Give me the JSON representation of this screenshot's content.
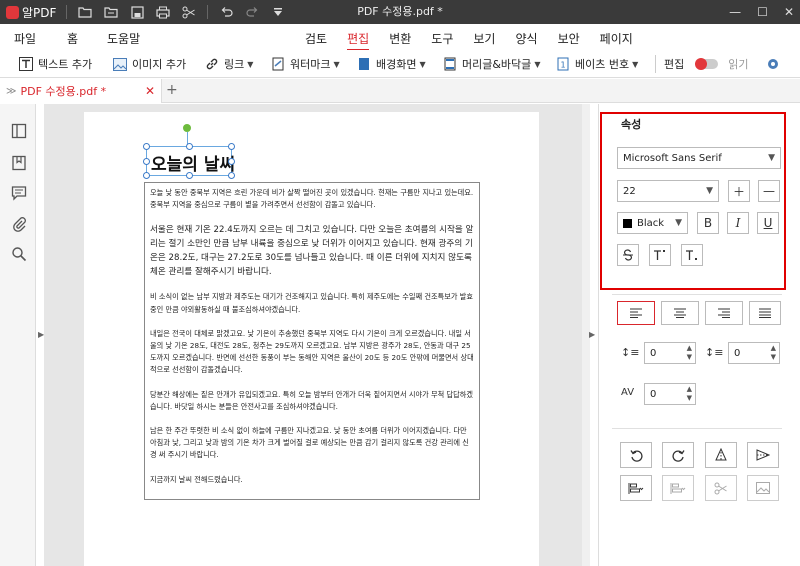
{
  "titlebar": {
    "app_name": "알PDF",
    "doc_title": "PDF 수정용.pdf *",
    "icons": [
      "folder-icon",
      "open-icon",
      "save-icon",
      "print-icon",
      "scissors-icon",
      "undo-icon",
      "redo-icon",
      "more-icon"
    ],
    "controls": [
      "minimize",
      "maximize",
      "close"
    ]
  },
  "menu": {
    "left": [
      "파일",
      "홈",
      "도움말"
    ],
    "center": [
      "검토",
      "편집",
      "변환",
      "도구",
      "보기",
      "양식",
      "보안",
      "페이지"
    ],
    "active": "편집"
  },
  "toolbar": {
    "add_text": "텍스트 추가",
    "add_image": "이미지 추가",
    "link": "링크",
    "watermark": "워터마크",
    "background": "배경화면",
    "header_footer": "머리글&바닥글",
    "bates": "베이츠 번호",
    "edit_label": "편집",
    "read_label": "읽기"
  },
  "tab": {
    "label": "PDF 수정용.pdf *",
    "add": "+"
  },
  "document": {
    "heading": "오늘의 날씨",
    "paragraphs": [
      {
        "text": "오늘 낮 동안 중북부 지역은 흐린 가운데 비가 살짝 떨어진 곳이 있겠습니다. 현재는 구름만 지나고 있는데요. 중북부 지역을 중심으로 구름이 볕을 가려주면서 선선함이 감돌고 있습니다.",
        "big": false
      },
      {
        "text": "서울은 현재 기온 22.4도까지 오르는 데 그치고 있습니다. 다만 오늘은 초여름의 시작을 알리는 절기 소만인 만큼 남부 내륙을 중심으로 낮 더위가 이어지고 있습니다. 현재 광주의 기온은 28.2도, 대구는 27.2도로 30도를 넘나들고 있습니다. 때 이른 더위에 지치지 않도록 체온 관리를 잘해주시기 바랍니다.",
        "big": true
      },
      {
        "text": "비 소식이 없는 남부 지방과 제주도는 대기가 건조해지고 있습니다. 특히 제주도에는 수일째 건조특보가 발효 중인 만큼 야외활동하실 때 불조심하셔야겠습니다.",
        "big": false
      },
      {
        "text": "내일은 전국이 대체로 맑겠고요. 낮 기온이 추송했던 중북부 지역도 다시 기온이 크게 오르겠습니다. 내일 서울의 낮 기온 28도, 대전도 28도, 청주는 29도까지 오르겠고요. 남부 지방은 광주가 28도, 안동과 대구 25도까지 오르겠습니다. 반면에 선선한 동풍이 부는 동해안 지역은 울산이 20도 등 20도 안팎에 머물면서 상대적으로 선선함이 감돌겠습니다.",
        "big": false
      },
      {
        "text": "당분간 해상에는 짙은 안개가 유입되겠고요. 특히 오늘 밤부터 안개가 더욱 짙어지면서 시야가 무척 답답하겠습니다. 바닷일 하시는 분들은 안전사고를 조심하셔야겠습니다.",
        "big": false
      },
      {
        "text": "남은 한 주간 뚜렷한 비 소식 없이 하늘에 구름만 지나겠고요. 낮 동안 초여름 더위가 이어지겠습니다. 다만 아침과 낮, 그리고 낮과 밤의 기온 차가 크게 벌어질 걸로 예상되는 만큼 감기 걸리지 않도록 건강 관리에 신경 써 주시기 바랍니다.",
        "big": false
      },
      {
        "text": "지금까지 날씨 전해드렸습니다.",
        "big": false
      }
    ]
  },
  "properties": {
    "title": "속성",
    "font_family": "Microsoft Sans Serif",
    "font_size": "22",
    "color_label": "Black",
    "color": "#000000",
    "style_buttons": [
      "B",
      "I",
      "U"
    ],
    "line_spacing": "0",
    "para_spacing": "0",
    "char_spacing": "0",
    "highlight_color": "#e00000",
    "accent_color": "#d9262c"
  }
}
